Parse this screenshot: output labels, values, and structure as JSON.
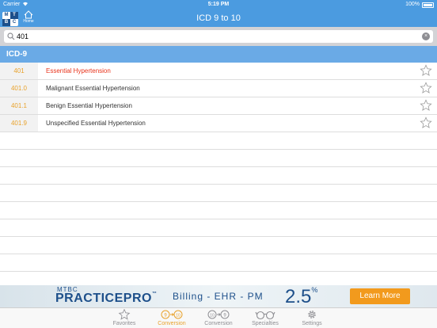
{
  "status_bar": {
    "carrier": "Carrier",
    "time": "5:19 PM",
    "battery": "100%"
  },
  "nav": {
    "logo": [
      "M",
      "T",
      "B",
      "C"
    ],
    "home_label": "Home",
    "title": "ICD 9 to 10"
  },
  "search": {
    "value": "401",
    "placeholder": ""
  },
  "section": {
    "title": "ICD-9"
  },
  "rows": [
    {
      "code": "401",
      "description": "Essential Hypertension",
      "selected": true
    },
    {
      "code": "401.0",
      "description": "Malignant Essential Hypertension",
      "selected": false
    },
    {
      "code": "401.1",
      "description": "Benign Essential Hypertension",
      "selected": false
    },
    {
      "code": "401.9",
      "description": "Unspecified Essential Hypertension",
      "selected": false
    }
  ],
  "banner": {
    "brand_top": "MTBC",
    "brand": "PRACTICEPRO",
    "trademark": "™",
    "tagline": "Billing - EHR - PM",
    "percent": "2.5",
    "percent_sign": "%",
    "cta": "Learn More"
  },
  "tabs": [
    {
      "label": "Favorites",
      "icon": "star-icon",
      "active": false
    },
    {
      "label": "Conversion",
      "icon": "icd9-to-icd10-icon",
      "active": true
    },
    {
      "label": "Conversion",
      "icon": "icd10-to-icd9-icon",
      "active": false
    },
    {
      "label": "Specialties",
      "icon": "glasses-icon",
      "active": false
    },
    {
      "label": "Settings",
      "icon": "gear-icon",
      "active": false
    }
  ],
  "icon_glyphs": {
    "icd9_to_10": [
      "9",
      "10"
    ],
    "icd10_to_9": [
      "10",
      "9"
    ]
  },
  "colors": {
    "nav": "#4b9be0",
    "section": "#6aaae6",
    "accent": "#e8a22c",
    "selected_text": "#e8341c",
    "cta": "#f29a1d"
  }
}
